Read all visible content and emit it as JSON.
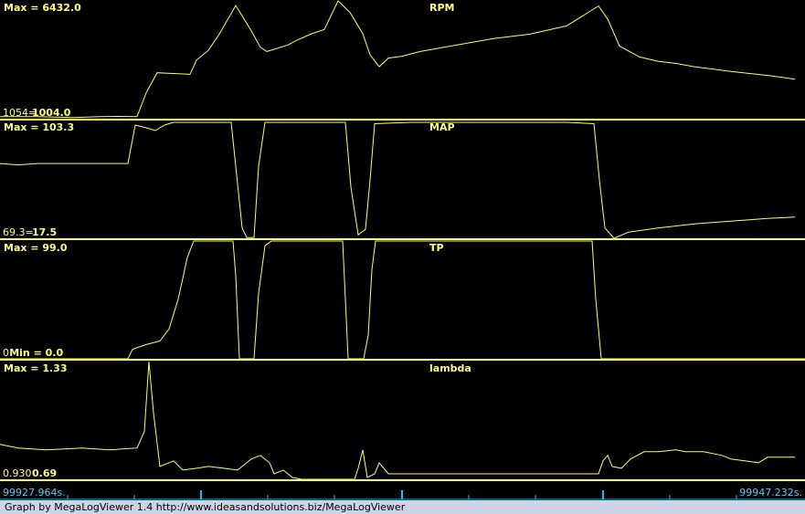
{
  "chart_data": {
    "type": "line",
    "time_start_label": "99927.964s.",
    "time_end_label": "99947.232s.",
    "colors": {
      "line": "#ffff66",
      "separator": "#ffff66",
      "axis": "#00c8ff",
      "background": "#000000"
    },
    "panels": [
      {
        "name": "RPM",
        "max_label": "Max = 6432.0",
        "min_label": "1004.0",
        "current_label": "1054=",
        "ylim": [
          1004,
          6432
        ],
        "series": [
          [
            0,
            1100
          ],
          [
            40,
            1100
          ],
          [
            80,
            1060
          ],
          [
            110,
            1100
          ],
          [
            130,
            1110
          ],
          [
            150,
            1100
          ],
          [
            160,
            2200
          ],
          [
            172,
            3120
          ],
          [
            195,
            3080
          ],
          [
            208,
            3050
          ],
          [
            215,
            3700
          ],
          [
            228,
            4150
          ],
          [
            240,
            4900
          ],
          [
            258,
            6220
          ],
          [
            275,
            5050
          ],
          [
            285,
            4300
          ],
          [
            292,
            4100
          ],
          [
            300,
            4200
          ],
          [
            315,
            4400
          ],
          [
            325,
            4620
          ],
          [
            340,
            4900
          ],
          [
            355,
            5120
          ],
          [
            370,
            6432
          ],
          [
            383,
            5900
          ],
          [
            397,
            4920
          ],
          [
            405,
            3950
          ],
          [
            415,
            3400
          ],
          [
            425,
            3800
          ],
          [
            440,
            3880
          ],
          [
            460,
            4100
          ],
          [
            500,
            4400
          ],
          [
            540,
            4700
          ],
          [
            580,
            4900
          ],
          [
            620,
            5280
          ],
          [
            640,
            5800
          ],
          [
            655,
            6200
          ],
          [
            665,
            5600
          ],
          [
            678,
            4350
          ],
          [
            700,
            3850
          ],
          [
            720,
            3650
          ],
          [
            740,
            3550
          ],
          [
            760,
            3400
          ],
          [
            800,
            3180
          ],
          [
            840,
            3000
          ],
          [
            870,
            2830
          ]
        ]
      },
      {
        "name": "MAP",
        "max_label": "Max = 103.3",
        "min_label": "17.5",
        "current_label": "69.3=",
        "ylim": [
          17.5,
          103.3
        ],
        "series": [
          [
            0,
            72
          ],
          [
            20,
            71
          ],
          [
            40,
            72
          ],
          [
            80,
            72
          ],
          [
            110,
            72
          ],
          [
            140,
            72
          ],
          [
            148,
            100
          ],
          [
            160,
            98
          ],
          [
            170,
            96
          ],
          [
            180,
            100
          ],
          [
            190,
            102
          ],
          [
            230,
            102
          ],
          [
            253,
            102
          ],
          [
            258,
            70
          ],
          [
            265,
            25
          ],
          [
            270,
            18
          ],
          [
            278,
            18
          ],
          [
            283,
            70
          ],
          [
            290,
            102
          ],
          [
            330,
            102
          ],
          [
            378,
            102
          ],
          [
            384,
            55
          ],
          [
            392,
            20
          ],
          [
            400,
            24
          ],
          [
            405,
            60
          ],
          [
            410,
            101
          ],
          [
            450,
            102
          ],
          [
            500,
            102
          ],
          [
            560,
            102
          ],
          [
            620,
            102
          ],
          [
            650,
            101
          ],
          [
            656,
            60
          ],
          [
            662,
            25
          ],
          [
            672,
            17.5
          ],
          [
            688,
            22
          ],
          [
            720,
            25
          ],
          [
            760,
            28
          ],
          [
            800,
            30
          ],
          [
            840,
            32
          ],
          [
            870,
            33
          ]
        ]
      },
      {
        "name": "TP",
        "max_label": "Max = 99.0",
        "min_label": "Min = 0.0",
        "current_label": "0",
        "ylim": [
          0,
          99
        ],
        "series": [
          [
            0,
            0
          ],
          [
            130,
            0
          ],
          [
            140,
            0
          ],
          [
            145,
            8
          ],
          [
            160,
            12
          ],
          [
            175,
            15
          ],
          [
            185,
            25
          ],
          [
            195,
            50
          ],
          [
            205,
            85
          ],
          [
            212,
            99
          ],
          [
            255,
            99
          ],
          [
            258,
            70
          ],
          [
            262,
            0
          ],
          [
            278,
            0
          ],
          [
            283,
            55
          ],
          [
            290,
            95
          ],
          [
            297,
            99
          ],
          [
            375,
            99
          ],
          [
            378,
            50
          ],
          [
            381,
            0
          ],
          [
            398,
            0
          ],
          [
            403,
            20
          ],
          [
            407,
            75
          ],
          [
            411,
            99
          ],
          [
            648,
            99
          ],
          [
            652,
            50
          ],
          [
            658,
            0
          ],
          [
            881,
            0
          ]
        ]
      },
      {
        "name": "lambda",
        "max_label": "Max = 1.33",
        "min_label": "0.69",
        "current_label": "0.930",
        "ylim": [
          0.69,
          1.33
        ],
        "series": [
          [
            0,
            0.88
          ],
          [
            20,
            0.86
          ],
          [
            50,
            0.85
          ],
          [
            90,
            0.86
          ],
          [
            120,
            0.85
          ],
          [
            150,
            0.86
          ],
          [
            158,
            0.95
          ],
          [
            163,
            1.33
          ],
          [
            168,
            1.05
          ],
          [
            175,
            0.76
          ],
          [
            190,
            0.79
          ],
          [
            200,
            0.74
          ],
          [
            215,
            0.75
          ],
          [
            228,
            0.76
          ],
          [
            245,
            0.75
          ],
          [
            260,
            0.74
          ],
          [
            275,
            0.8
          ],
          [
            285,
            0.82
          ],
          [
            295,
            0.78
          ],
          [
            300,
            0.72
          ],
          [
            310,
            0.74
          ],
          [
            320,
            0.7
          ],
          [
            330,
            0.69
          ],
          [
            388,
            0.69
          ],
          [
            392,
            0.75
          ],
          [
            397,
            0.85
          ],
          [
            402,
            0.7
          ],
          [
            410,
            0.72
          ],
          [
            415,
            0.78
          ],
          [
            425,
            0.72
          ],
          [
            500,
            0.72
          ],
          [
            600,
            0.72
          ],
          [
            655,
            0.72
          ],
          [
            660,
            0.79
          ],
          [
            665,
            0.82
          ],
          [
            670,
            0.76
          ],
          [
            680,
            0.75
          ],
          [
            690,
            0.8
          ],
          [
            705,
            0.84
          ],
          [
            720,
            0.84
          ],
          [
            740,
            0.85
          ],
          [
            750,
            0.84
          ],
          [
            770,
            0.84
          ],
          [
            790,
            0.82
          ],
          [
            800,
            0.8
          ],
          [
            815,
            0.79
          ],
          [
            830,
            0.78
          ],
          [
            840,
            0.81
          ],
          [
            870,
            0.81
          ]
        ]
      }
    ]
  },
  "footer": {
    "text": "Graph by MegaLogViewer 1.4 http://www.ideasandsolutions.biz/MegaLogViewer"
  }
}
